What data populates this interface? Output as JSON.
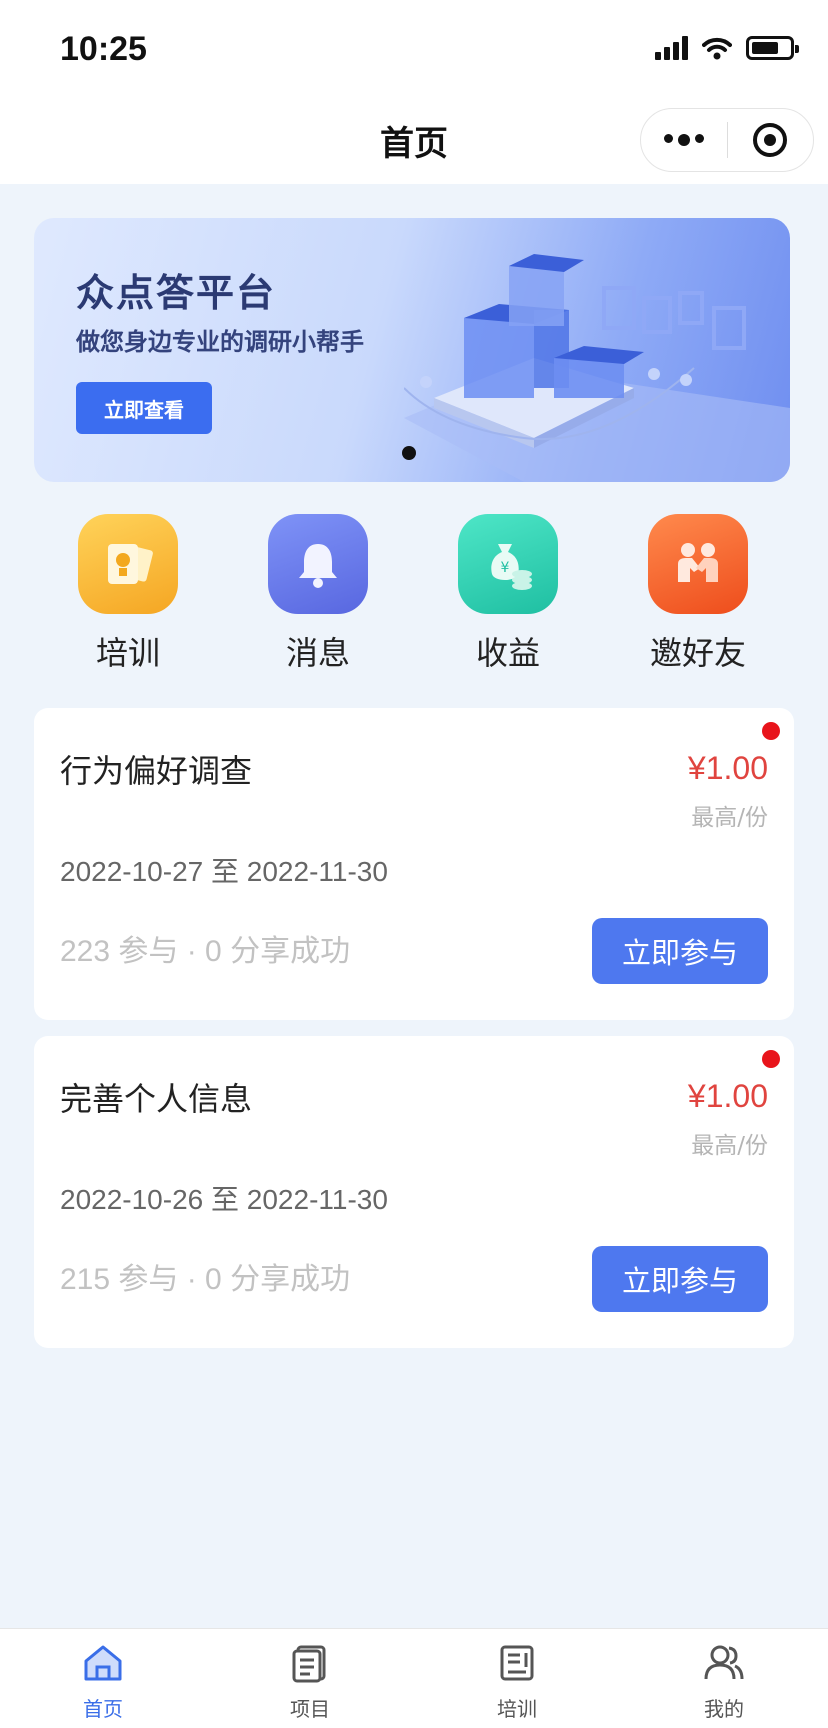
{
  "status_bar": {
    "time": "10:25"
  },
  "nav": {
    "title": "首页"
  },
  "banner": {
    "title": "众点答平台",
    "subtitle": "做您身边专业的调研小帮手",
    "button_label": "立即查看"
  },
  "quick_menu": [
    {
      "label": "培训",
      "icon": "certificate-icon",
      "color": "#f7b32b"
    },
    {
      "label": "消息",
      "icon": "bell-icon",
      "color": "#6a7ff0"
    },
    {
      "label": "收益",
      "icon": "money-bag-icon",
      "color": "#2fd3b5"
    },
    {
      "label": "邀好友",
      "icon": "handshake-icon",
      "color": "#f5622e"
    }
  ],
  "tasks": [
    {
      "title": "行为偏好调查",
      "price": "¥1.00",
      "price_unit": "最高/份",
      "date_range": "2022-10-27 至 2022-11-30",
      "stats": "223 参与 · 0 分享成功",
      "button_label": "立即参与"
    },
    {
      "title": "完善个人信息",
      "price": "¥1.00",
      "price_unit": "最高/份",
      "date_range": "2022-10-26 至 2022-11-30",
      "stats": "215 参与 · 0 分享成功",
      "button_label": "立即参与"
    }
  ],
  "tab_bar": [
    {
      "label": "首页",
      "icon": "home-icon",
      "active": true
    },
    {
      "label": "项目",
      "icon": "document-icon",
      "active": false
    },
    {
      "label": "培训",
      "icon": "training-icon",
      "active": false
    },
    {
      "label": "我的",
      "icon": "users-icon",
      "active": false
    }
  ],
  "colors": {
    "primary": "#4e78ef",
    "price": "#e0443f",
    "badge": "#e8141b",
    "tab_active": "#3a6ee8"
  }
}
